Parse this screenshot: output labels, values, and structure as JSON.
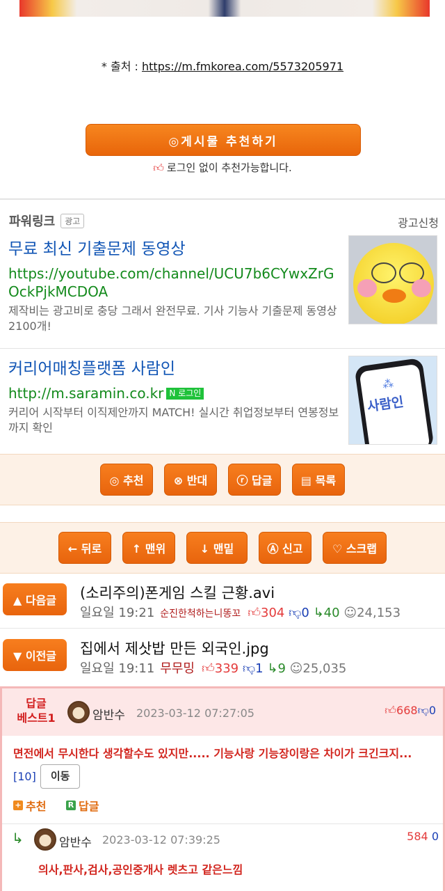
{
  "source": {
    "prefix": "* 출처 : ",
    "url": "https://m.fmkorea.com/5573205971"
  },
  "recommend": {
    "button": "◎게시물  추천하기",
    "note_icon": "thumbs-up-icon",
    "note": "로그인 없이 추천가능합니다."
  },
  "ads": {
    "header": "파워링크",
    "badge": "광고",
    "apply": "광고신청",
    "items": [
      {
        "title": "무료 최신 기출문제 동영상",
        "url": "https://youtube.com/channel/UCU7b6CYwxZrGOckPjkMCDOA",
        "desc": "제작비는 광고비로 충당 그래서 완전무료. 기사 기능사 기출문제 동영상 2100개!"
      },
      {
        "title": "커리어매칭플랫폼 사람인",
        "url": "http://m.saramin.co.kr",
        "login_badge": "N 로그인",
        "desc": "커리어 시작부터 이직제안까지 MATCH! 실시간 취업정보부터 연봉정보까지 확인",
        "image_brand": "사람인"
      }
    ]
  },
  "vote_bar": [
    "◎ 추천",
    "⊗ 반대",
    "ⓡ 답글",
    "▤ 목록"
  ],
  "nav_bar": [
    "← 뒤로",
    "↑ 맨위",
    "↓ 맨밑",
    "Ⓐ 신고",
    "♡ 스크랩"
  ],
  "next_post": {
    "button": "▲ 다음글",
    "title": "(소리주의)폰게임 스킬 근황.avi",
    "date": "일요일 19:21",
    "nick": "순진한척하는니똥꼬",
    "likes": "304",
    "dislikes": "0",
    "replies": "40",
    "views": "24,153"
  },
  "prev_post": {
    "button": "▼ 이전글",
    "title": "집에서 제삿밥 만든 외국인.jpg",
    "date": "일요일 19:11",
    "nick": "무무밍",
    "likes": "339",
    "dislikes": "1",
    "replies": "9",
    "views": "25,035"
  },
  "best_comment": {
    "label_line1": "답글",
    "label_line2": "베스트1",
    "nick": "암반수",
    "date": "2023-03-12 07:27:05",
    "likes": "668",
    "dislikes": "0",
    "text": "면전에서 무시한다 생각할수도 있지만..... 기능사랑 기능장이랑은 차이가 크긴크지...",
    "reply_count": "[10]",
    "move": "이동",
    "recommend": "추천",
    "reply": "답글"
  },
  "reply_comment": {
    "nick": "암반수",
    "date": "2023-03-12 07:39:25",
    "likes": "584",
    "dislikes": "0",
    "text": "의사,판사,검사,공인중개사 렛츠고 같은느낌"
  }
}
